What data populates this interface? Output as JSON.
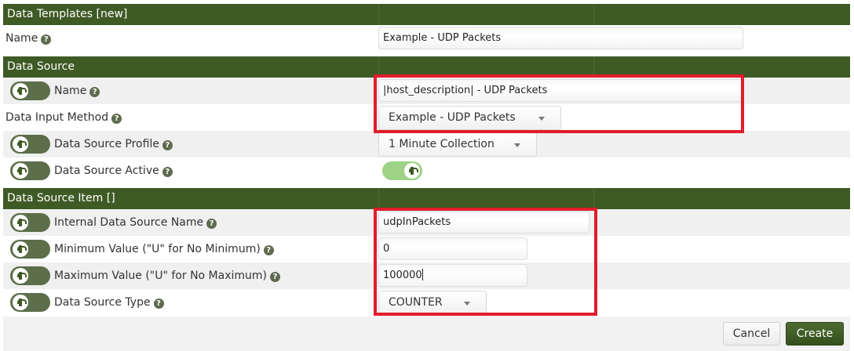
{
  "sections": {
    "templates_title": "Data Templates [new]",
    "source_title": "Data Source",
    "item_title": "Data Source Item []"
  },
  "template": {
    "name_label": "Name",
    "name_value": "Example - UDP Packets"
  },
  "source": {
    "name_label": "Name",
    "name_value": "|host_description| - UDP Packets",
    "input_method_label": "Data Input Method",
    "input_method_value": "Example - UDP Packets",
    "profile_label": "Data Source Profile",
    "profile_value": "1 Minute Collection",
    "active_label": "Data Source Active",
    "active_checked": true
  },
  "item": {
    "internal_name_label": "Internal Data Source Name",
    "internal_name_value": "udpInPackets",
    "min_label": "Minimum Value (\"U\" for No Minimum)",
    "min_value": "0",
    "max_label": "Maximum Value (\"U\" for No Maximum)",
    "max_value": "100000",
    "type_label": "Data Source Type",
    "type_value": "COUNTER"
  },
  "buttons": {
    "cancel": "Cancel",
    "create": "Create"
  },
  "colors": {
    "header_bg": "#3e5a25",
    "toggle_off": "#5c6e4a",
    "toggle_on": "#9ed286",
    "highlight": "#e21c2a"
  },
  "icons": {
    "help": "help-icon",
    "toggle": "toggle-icon",
    "select_caret": "chevron-down-icon"
  }
}
